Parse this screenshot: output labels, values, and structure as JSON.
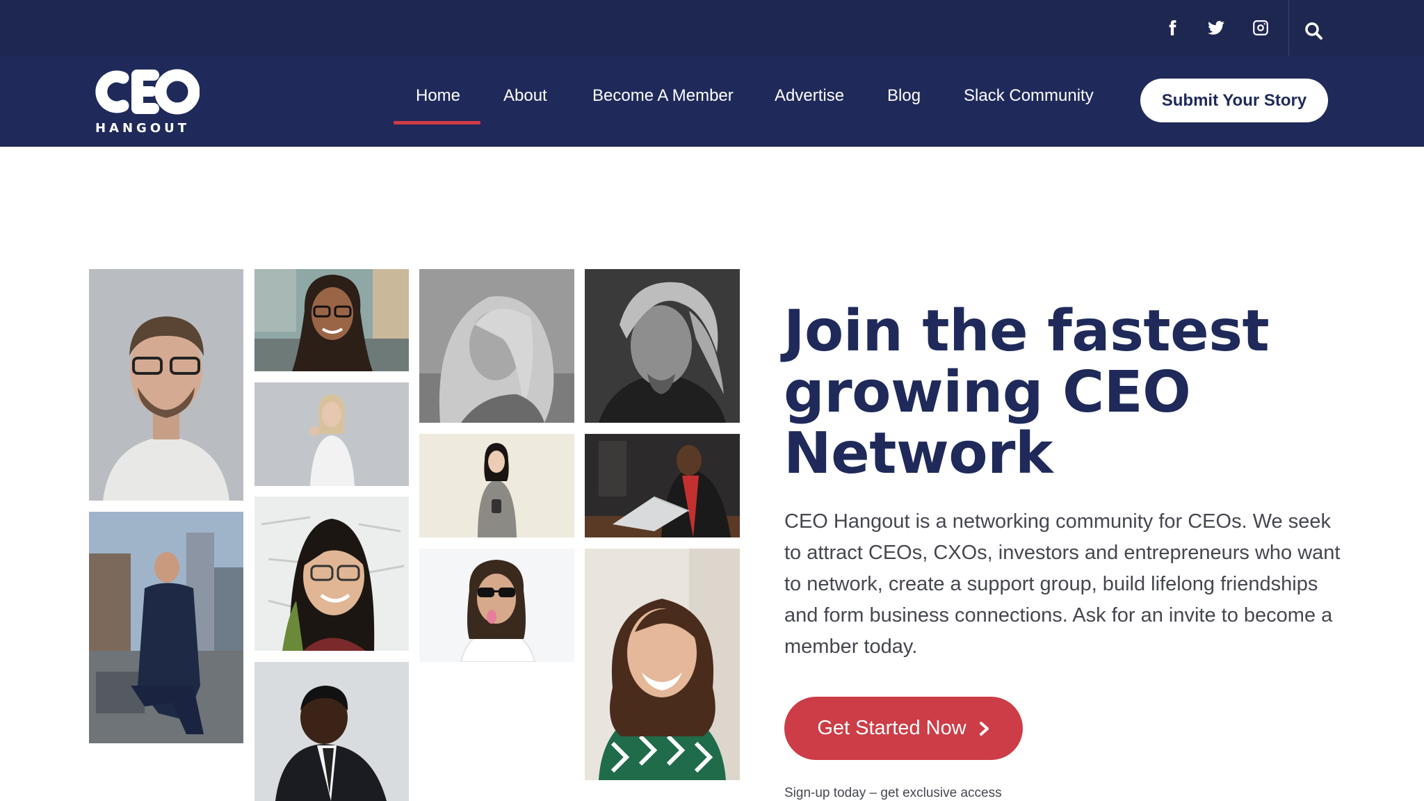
{
  "topbar": {
    "social": [
      "facebook-icon",
      "twitter-icon",
      "instagram-icon"
    ],
    "search_icon": "search-icon"
  },
  "brand": {
    "logo_word": "CEO",
    "logo_sub": "HANGOUT"
  },
  "nav": {
    "items": [
      {
        "label": "Home",
        "active": true
      },
      {
        "label": "About"
      },
      {
        "label": "Become A Member"
      },
      {
        "label": "Advertise"
      },
      {
        "label": "Blog"
      },
      {
        "label": "Slack Community"
      }
    ],
    "submit_label": "Submit Your Story"
  },
  "hero": {
    "headline": "Join the fastest growing CEO Network",
    "description": "CEO Hangout is a networking community for CEOs. We seek to attract CEOs, CXOs, investors and entrepreneurs who want to network, create a support group, build lifelong friendships and form business connections. Ask for an invite to become a member today.",
    "cta_label": "Get Started Now",
    "cta_icon": "chevron-right-icon",
    "signup_note": "Sign-up today – get exclusive access"
  },
  "colors": {
    "topbar_bg": "#1e2750",
    "nav_bg": "#1f2a5a",
    "headline": "#1f2a5a",
    "accent": "#cc3d47",
    "text": "#45474f"
  }
}
